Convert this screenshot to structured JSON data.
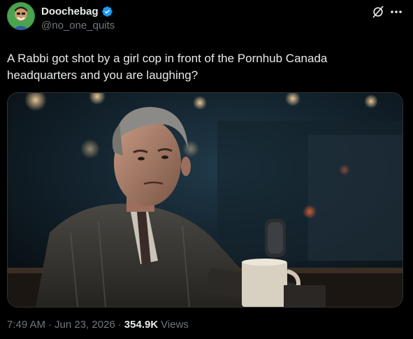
{
  "user": {
    "display_name": "Doochebag",
    "handle": "@no_one_quits",
    "verified": true
  },
  "tweet": {
    "text": "A Rabbi got shot by a girl cop in front of the Pornhub Canada headquarters and you are laughing?",
    "time": "7:49 AM",
    "date": "Jun 23, 2026",
    "separator": "·",
    "views_count": "354.9K",
    "views_label": "Views"
  },
  "icons": {
    "verified": "verified-badge-icon",
    "grok": "grok-icon",
    "more": "more-icon"
  },
  "colors": {
    "background": "#000000",
    "text_primary": "#e7e9ea",
    "text_secondary": "#71767b",
    "verified_blue": "#1d9bf0",
    "border": "#2f3336"
  }
}
